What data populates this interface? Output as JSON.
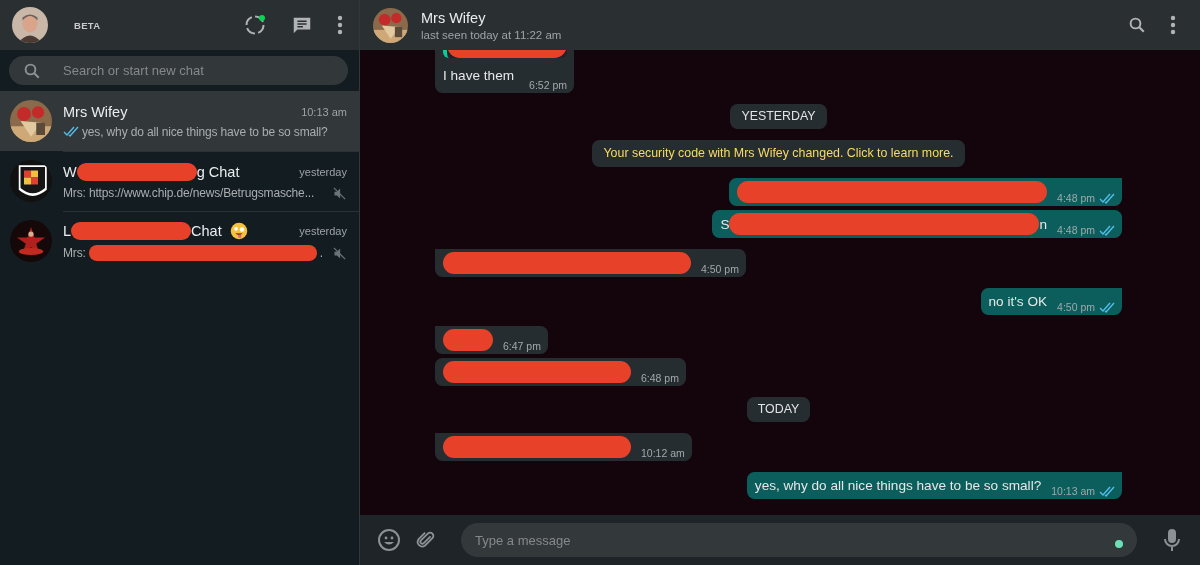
{
  "profile": {
    "badge": "BETA",
    "status_unread": true
  },
  "search": {
    "placeholder": "Search or start new chat"
  },
  "chats": [
    {
      "name": [
        {
          "kind": "text",
          "text": "Mrs Wifey"
        }
      ],
      "emoji": false,
      "time": "10:13 am",
      "read_ticks": true,
      "preview": [
        {
          "kind": "text",
          "text": "yes, why do all nice things have to be so small?"
        }
      ],
      "muted": false,
      "selected": true
    },
    {
      "name": [
        {
          "kind": "text",
          "text": "W"
        },
        {
          "kind": "short"
        },
        {
          "kind": "text",
          "text": "g Chat"
        }
      ],
      "emoji": false,
      "time": "yesterday",
      "read_ticks": false,
      "preview": [
        {
          "kind": "text",
          "text": "Mrs: https://www.chip.de/news/Betrugsmasche..."
        }
      ],
      "muted": true,
      "selected": false
    },
    {
      "name": [
        {
          "kind": "text",
          "text": "L"
        },
        {
          "kind": "short"
        },
        {
          "kind": "text",
          "text": "Chat"
        }
      ],
      "emoji": true,
      "time": "yesterday",
      "read_ticks": false,
      "preview": [
        {
          "kind": "text",
          "text": "Mrs:"
        },
        {
          "kind": "long"
        },
        {
          "kind": "text",
          "text": "."
        }
      ],
      "muted": true,
      "selected": false
    }
  ],
  "conversation": {
    "name": "Mrs Wifey",
    "status": "last seen today at 11:22 am"
  },
  "messages": [
    {
      "kind": "in",
      "tail": false,
      "quote": [
        {
          "kind": "short"
        }
      ],
      "segments": [
        {
          "kind": "text",
          "text": "I have them"
        }
      ],
      "time": "6:52 pm"
    },
    {
      "kind": "date",
      "text": "YESTERDAY"
    },
    {
      "kind": "system",
      "text": "Your security code with Mrs Wifey changed. Click to learn more."
    },
    {
      "kind": "out",
      "tail": true,
      "segments": [
        {
          "kind": "wide"
        }
      ],
      "time": "4:48 pm",
      "read": true
    },
    {
      "kind": "out",
      "tail": false,
      "segments": [
        {
          "kind": "text",
          "text": "S"
        },
        {
          "kind": "wide"
        },
        {
          "kind": "text",
          "text": "n"
        }
      ],
      "time": "4:48 pm",
      "read": true
    },
    {
      "kind": "in",
      "tail": true,
      "segments": [
        {
          "kind": "long"
        }
      ],
      "time": "4:50 pm"
    },
    {
      "kind": "out",
      "tail": true,
      "segments": [
        {
          "kind": "text",
          "text": "no it's OK"
        }
      ],
      "time": "4:50 pm",
      "read": true
    },
    {
      "kind": "in",
      "tail": true,
      "segments": [
        {
          "kind": "tiny"
        }
      ],
      "time": "6:47 pm"
    },
    {
      "kind": "in",
      "tail": false,
      "segments": [
        {
          "kind": "medium"
        }
      ],
      "time": "6:48 pm"
    },
    {
      "kind": "date",
      "text": "TODAY"
    },
    {
      "kind": "in",
      "tail": true,
      "segments": [
        {
          "kind": "medium"
        }
      ],
      "time": "10:12 am"
    },
    {
      "kind": "out",
      "tail": true,
      "segments": [
        {
          "kind": "text",
          "text": "yes, why do all nice things have to be so small?"
        }
      ],
      "time": "10:13 am",
      "read": true
    }
  ],
  "composer": {
    "placeholder": "Type a message"
  }
}
